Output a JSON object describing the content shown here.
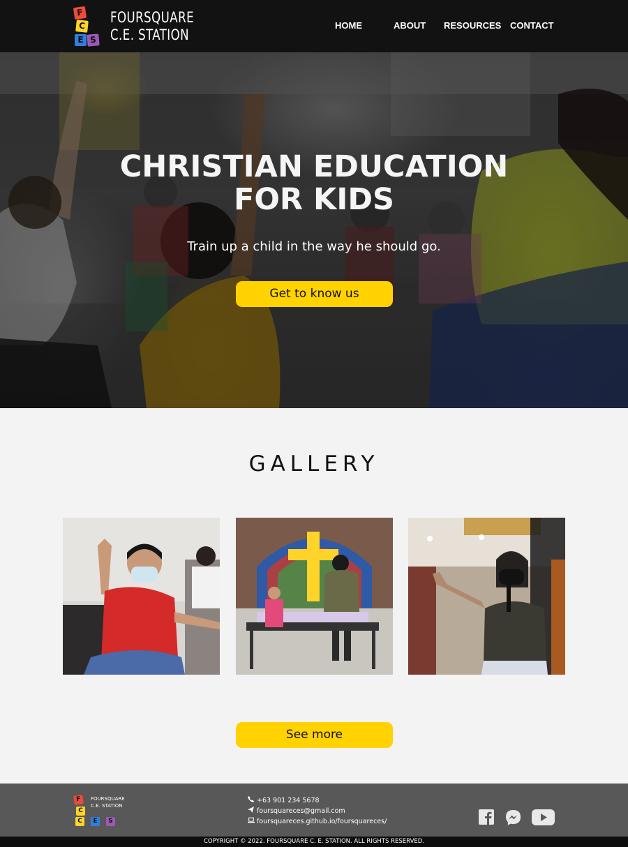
{
  "brand": {
    "logo_letters": [
      "F",
      "C",
      "E",
      "S"
    ],
    "logo_line1": "FOURSQUARE",
    "logo_line2": "C.E. STATION",
    "colors": {
      "red": "#f04a3a",
      "yellow": "#ffd42a",
      "blue": "#2f7fe0",
      "purple": "#9b59b6"
    }
  },
  "nav": {
    "items": [
      {
        "label": "HOME"
      },
      {
        "label": "ABOUT"
      },
      {
        "label": "RESOURCES"
      },
      {
        "label": "CONTACT"
      }
    ]
  },
  "hero": {
    "title_line1": "CHRISTIAN EDUCATION",
    "title_line2": "FOR KIDS",
    "subtitle": "Train up a child in the way he should go.",
    "cta_label": "Get to know us"
  },
  "gallery": {
    "title": "GALLERY",
    "photos": [
      "boy-raising-hand-photo",
      "man-at-stained-glass-cross-photo",
      "woman-with-microphone-photo"
    ],
    "more_label": "See more"
  },
  "footer": {
    "logo_line1": "FOURSQUARE",
    "logo_line2": "C.E. STATION",
    "phone": "+63 901 234 5678",
    "email": "foursquareces@gmail.com",
    "website": "foursquareces.github.io/foursquareces/",
    "social": [
      "facebook-icon",
      "messenger-icon",
      "youtube-icon"
    ],
    "copyright": "COPYRIGHT © 2022. FOURSQUARE C. E. STATION. ALL RIGHTS RESERVED."
  },
  "accent_color": "#ffd200"
}
